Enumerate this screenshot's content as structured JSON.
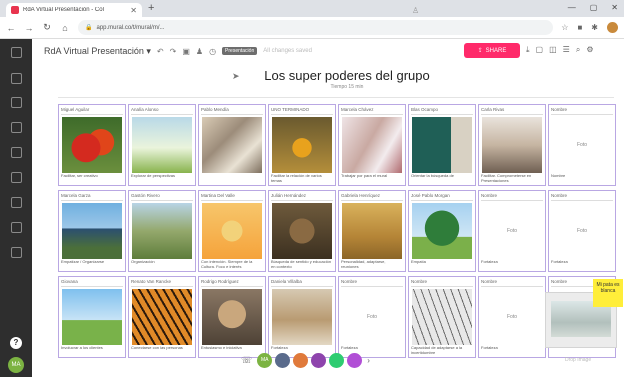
{
  "browser": {
    "tab_title": "RdA Virtual Presentación - Col",
    "url": "app.mural.co/t/mural/m/...",
    "new_tab": "+",
    "window_controls": [
      "—",
      "▢",
      "✕"
    ]
  },
  "app": {
    "doc_title": "RdA Virtual Presentación ▾",
    "badge": "Presentación",
    "ghost_text": "All changes saved",
    "share_label": "SHARE"
  },
  "board": {
    "title": "Los super poderes del grupo",
    "subtitle": "Tiempo 15 min"
  },
  "rows": [
    [
      {
        "name": "Miguel Aguilar",
        "img": "i-butterfly",
        "caption": "Facilitar, ser creativo"
      },
      {
        "name": "Analía Alonso",
        "img": "i-plants",
        "caption": "Explorar de perspectivas"
      },
      {
        "name": "Pablo Mendía",
        "img": "i-pills",
        "caption": ""
      },
      {
        "name": "UNO TERMINADO",
        "img": "i-bee",
        "caption": "Facilitar la relación de varios temas"
      },
      {
        "name": "Marcela Chávez",
        "img": "i-hands",
        "caption": "Trabajar por para el mural"
      },
      {
        "name": "Blas Ocampo",
        "img": "i-teacher",
        "caption": "Orientar la búsqueda de"
      },
      {
        "name": "Carla Rivas",
        "img": "i-meeting",
        "caption": "Facilitar. Comprometerse en Presentaciones"
      },
      {
        "name": "Nombre",
        "placeholder": "Foto",
        "caption": "Nombre"
      }
    ],
    [
      {
        "name": "Marcela Garza",
        "img": "i-volcano",
        "caption": "Empatizar / Organizarse"
      },
      {
        "name": "Gastón Rivero",
        "img": "i-field",
        "caption": "Organización"
      },
      {
        "name": "Martina Del Valle",
        "img": "i-cartoon",
        "caption": "Con intención. Siempre de la Cultura. Foco e interés"
      },
      {
        "name": "Julián Hernández",
        "img": "i-lion",
        "caption": "Búsqueda de sentido y educación en contexto"
      },
      {
        "name": "Gabriela Henríquez",
        "img": "i-runner",
        "caption": "Personalidad, adaptarse, reuniones"
      },
      {
        "name": "José Pablo Morgan",
        "img": "i-tree",
        "caption": "Empatía"
      },
      {
        "name": "Nombre",
        "placeholder": "Foto",
        "caption": "Fortaleza"
      },
      {
        "name": "Nombre",
        "placeholder": "Foto",
        "caption": "Fortaleza"
      }
    ],
    [
      {
        "name": "Giovana",
        "img": "i-freedom",
        "caption": "Involucrar a los clientes"
      },
      {
        "name": "Renato Van Rancke",
        "img": "i-tiger",
        "caption": "Conectarse con las personas"
      },
      {
        "name": "Rodrigo Rodríguez",
        "img": "i-cougar",
        "caption": "Entusiasmo e iniciativa"
      },
      {
        "name": "Daniela Villalba",
        "img": "i-lioness",
        "caption": "Fortaleza"
      },
      {
        "name": "Nombre",
        "placeholder": "Foto",
        "caption": "Fortaleza"
      },
      {
        "name": "Nombre",
        "img": "i-whitetiger",
        "caption": "Capacidad de adaptarse a la incertidumbre"
      },
      {
        "name": "Nombre",
        "placeholder": "Foto",
        "caption": "Fortaleza"
      },
      {
        "name": "Nombre",
        "placeholder": "",
        "caption": ""
      }
    ]
  ],
  "sticky": {
    "text": "Mi pata es blanca"
  },
  "drag_hint": "Drop Image",
  "collaborators": [
    {
      "initials": "MA",
      "color": "#7cb342"
    },
    {
      "initials": "",
      "color": "#5a6b8c"
    },
    {
      "initials": "",
      "color": "#e07a3b"
    },
    {
      "initials": "",
      "color": "#8e44ad"
    },
    {
      "initials": "",
      "color": "#2ecc71"
    },
    {
      "initials": "",
      "color": "#b14fd6"
    }
  ],
  "more_label": "›"
}
